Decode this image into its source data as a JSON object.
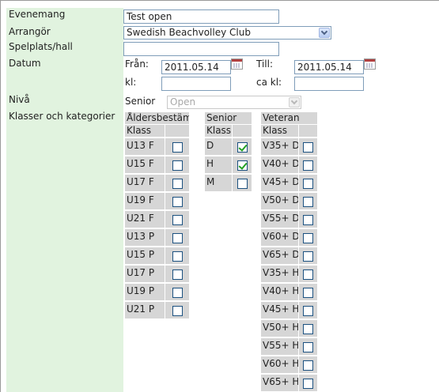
{
  "labels": {
    "evenemang": "Evenemang",
    "arrangor": "Arrangör",
    "spelplats": "Spelplats/hall",
    "datum": "Datum",
    "niva": "Nivå",
    "klasser": "Klasser och kategorier"
  },
  "evenemang_value": "Test open",
  "arrangor_value": "Swedish Beachvolley Club",
  "spelplats_value": "",
  "datum": {
    "fran_label": "Från:",
    "fran_value": "2011.05.14",
    "till_label": "Till:",
    "till_value": "2011.05.14",
    "kl_label": "kl:",
    "kl_value": "",
    "cakl_label": "ca kl:",
    "cakl_value": ""
  },
  "niva": {
    "label": "Senior",
    "value": "Open"
  },
  "groups": {
    "aldersbestamt": {
      "title": "Åldersbestämt",
      "header": "Klass",
      "rows": [
        {
          "label": "U13 F",
          "checked": false
        },
        {
          "label": "U15 F",
          "checked": false
        },
        {
          "label": "U17 F",
          "checked": false
        },
        {
          "label": "U19 F",
          "checked": false
        },
        {
          "label": "U21 F",
          "checked": false
        },
        {
          "label": "U13 P",
          "checked": false
        },
        {
          "label": "U15 P",
          "checked": false
        },
        {
          "label": "U17 P",
          "checked": false
        },
        {
          "label": "U19 P",
          "checked": false
        },
        {
          "label": "U21 P",
          "checked": false
        }
      ]
    },
    "senior": {
      "title": "Senior",
      "header": "Klass",
      "rows": [
        {
          "label": "D",
          "checked": true
        },
        {
          "label": "H",
          "checked": true
        },
        {
          "label": "M",
          "checked": false
        }
      ]
    },
    "veteran": {
      "title": "Veteran",
      "header": "Klass",
      "rows": [
        {
          "label": "V35+ D",
          "checked": false
        },
        {
          "label": "V40+ D",
          "checked": false
        },
        {
          "label": "V45+ D",
          "checked": false
        },
        {
          "label": "V50+ D",
          "checked": false
        },
        {
          "label": "V55+ D",
          "checked": false
        },
        {
          "label": "V60+ D",
          "checked": false
        },
        {
          "label": "V65+ D",
          "checked": false
        },
        {
          "label": "V35+ H",
          "checked": false
        },
        {
          "label": "V40+ H",
          "checked": false
        },
        {
          "label": "V45+ H",
          "checked": false
        },
        {
          "label": "V50+ H",
          "checked": false
        },
        {
          "label": "V55+ H",
          "checked": false
        },
        {
          "label": "V60+ H",
          "checked": false
        },
        {
          "label": "V65+ H",
          "checked": false
        }
      ]
    }
  }
}
